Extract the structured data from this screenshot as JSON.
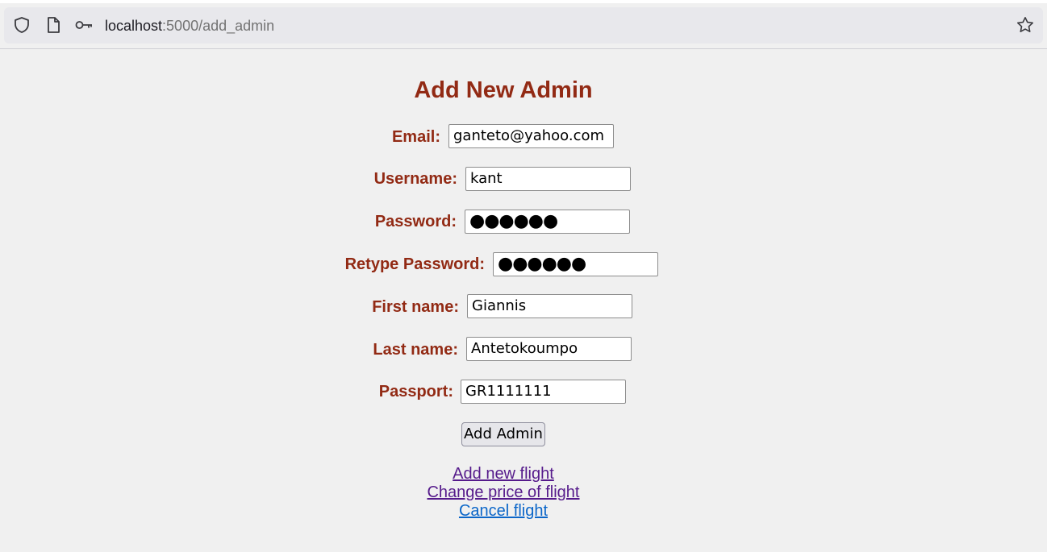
{
  "browser": {
    "url_host": "localhost",
    "url_path": ":5000/add_admin",
    "icons": [
      "shield-icon",
      "page-icon",
      "key-icon",
      "star-icon"
    ]
  },
  "page": {
    "title": "Add New Admin",
    "fields": {
      "email": {
        "label": "Email:",
        "value": "ganteto@yahoo.com"
      },
      "username": {
        "label": "Username:",
        "value": "kant"
      },
      "password": {
        "label": "Password:",
        "value": "●●●●●●"
      },
      "retype_password": {
        "label": "Retype Password:",
        "value": "●●●●●●"
      },
      "first_name": {
        "label": "First name:",
        "value": "Giannis"
      },
      "last_name": {
        "label": "Last name:",
        "value": "Antetokoumpo"
      },
      "passport": {
        "label": "Passport:",
        "value": "GR1111111"
      }
    },
    "submit_label": "Add Admin",
    "links": {
      "add_flight": "Add new flight",
      "change_price": "Change price of flight",
      "cancel_flight": "Cancel flight"
    },
    "colors": {
      "accent": "#922a14",
      "visited_link": "#551a8b",
      "link": "#0b66c9",
      "background": "#f0f0f0"
    }
  }
}
